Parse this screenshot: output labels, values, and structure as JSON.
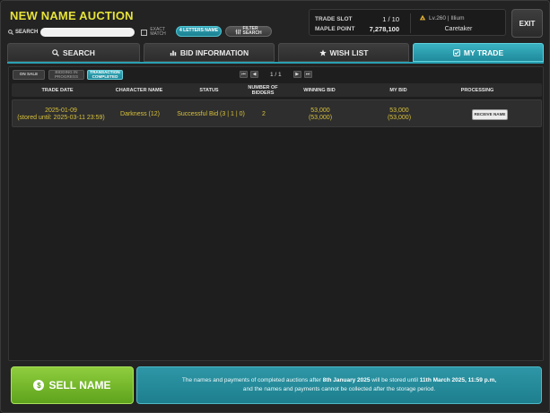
{
  "header": {
    "title": "NEW NAME AUCTION",
    "search_label": "SEARCH",
    "search_placeholder": "",
    "search_value": "",
    "exact_match_label": "EXACT MATCH",
    "four_letters_label": "4 LETTERS NAME",
    "filter_label": "FILTER SEARCH"
  },
  "trade_info": {
    "trade_slot_label": "TRADE SLOT",
    "trade_slot_value": "1 / 10",
    "maple_point_label": "MAPLE POINT",
    "maple_point_value": "7,278,100",
    "char_info": "Lv.260 | Illium",
    "job": "Caretaker"
  },
  "exit_label": "EXIT",
  "tabs": [
    {
      "label": "SEARCH",
      "icon": "search-icon"
    },
    {
      "label": "BID INFORMATION",
      "icon": "bar-chart-icon"
    },
    {
      "label": "WISH LIST",
      "icon": "star-icon"
    },
    {
      "label": "MY TRADE",
      "icon": "checkbox-icon"
    }
  ],
  "sub_tabs": [
    "ON SALE",
    "BIDDING IN PROGRESS",
    "TRANSACTION COMPLETED"
  ],
  "pager": {
    "text": "1 / 1"
  },
  "columns": [
    "TRADE DATE",
    "CHARACTER NAME",
    "STATUS",
    "NUMBER OF BIDDERS",
    "WINNING BID",
    "MY BID",
    "PROCESSING"
  ],
  "rows": [
    {
      "date": "2025-01-09",
      "stored": "(stored until: 2025-03-11 23:59)",
      "character": "Darkness (12)",
      "status": "Successful Bid (3 | 1 | 0)",
      "bidders": "2",
      "winning_bid": "53,000",
      "winning_bid_sub": "(53,000)",
      "my_bid": "53,000",
      "my_bid_sub": "(53,000)",
      "action": "RECEIVE NAME"
    }
  ],
  "sell_button": "SELL NAME",
  "notice": {
    "line1_a": "The names and payments of completed auctions after ",
    "line1_b": "8th January 2025",
    "line1_c": " will be stored until ",
    "line1_d": "11th March 2025, 11:59 p.m,",
    "line2": "and the names and payments cannot be collected after the storage period."
  },
  "colors": {
    "accent": "#2aa0b2",
    "title": "#e6e23a",
    "row_text": "#d9c23b",
    "sell": "#7ab82e"
  }
}
